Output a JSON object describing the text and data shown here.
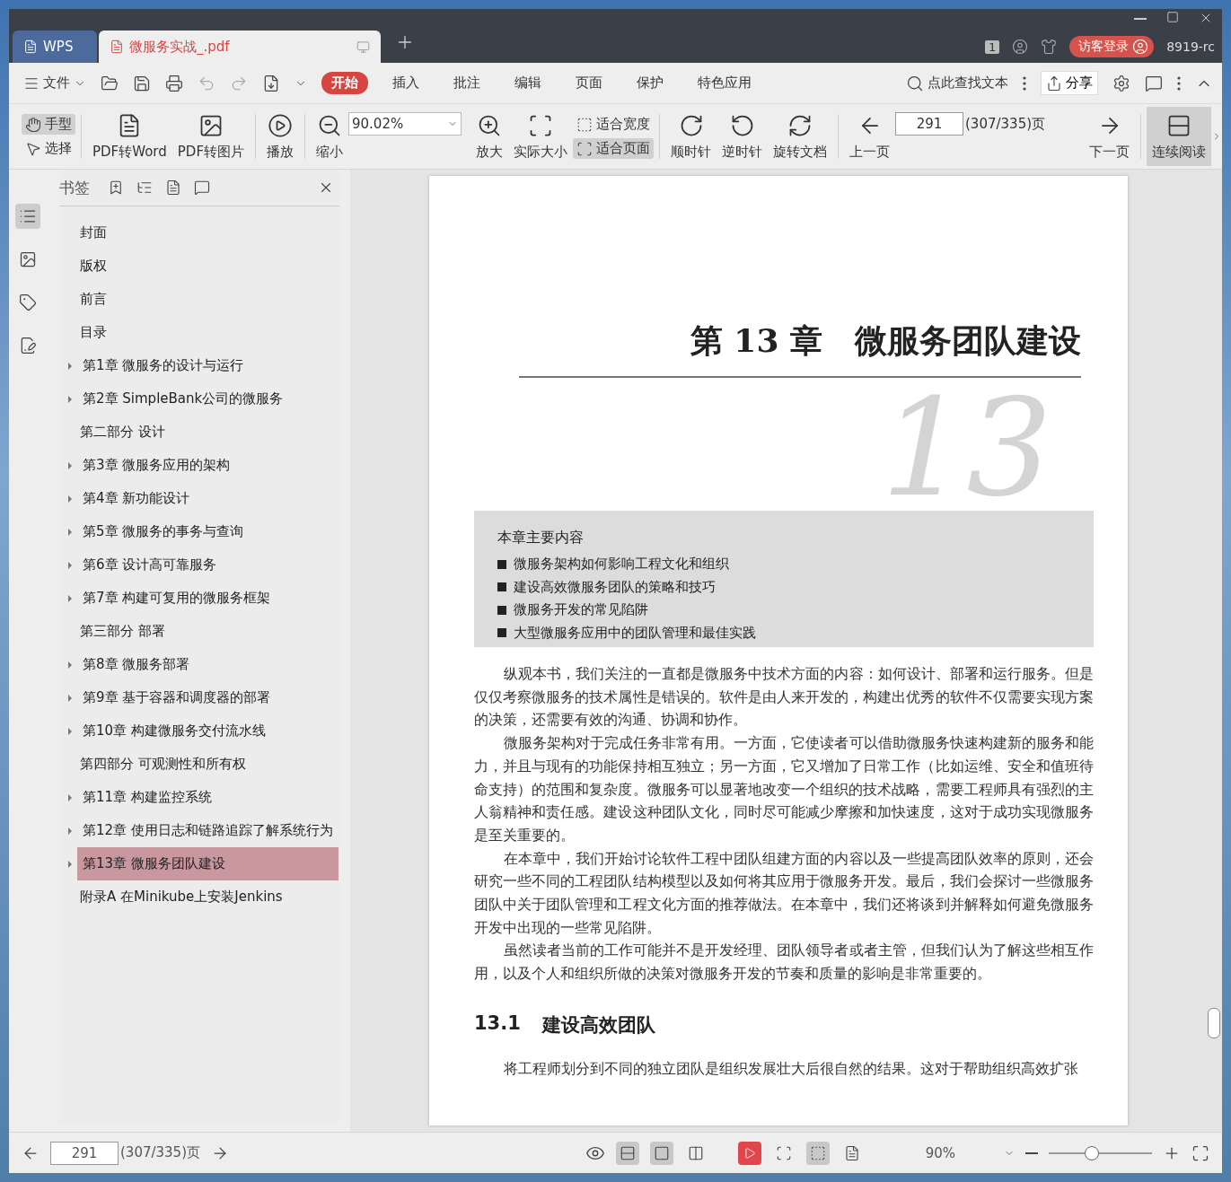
{
  "titlebar": {
    "tabs": [
      {
        "label": "WPS",
        "kind": "home",
        "selected": false
      },
      {
        "label": "微服务实战_.pdf",
        "kind": "doc",
        "selected": true
      }
    ],
    "badge": "1",
    "login": "访客登录",
    "user": "8919-rc"
  },
  "menubar": {
    "file": "文件",
    "tabs": [
      {
        "label": "开始",
        "selected": true
      },
      {
        "label": "插入",
        "selected": false
      },
      {
        "label": "批注",
        "selected": false
      },
      {
        "label": "编辑",
        "selected": false
      },
      {
        "label": "页面",
        "selected": false
      },
      {
        "label": "保护",
        "selected": false
      },
      {
        "label": "特色应用",
        "selected": false
      }
    ],
    "search": "点此查找文本",
    "share": "分享"
  },
  "toolbar": [
    {
      "kind": "pair",
      "items": [
        {
          "label": "手型",
          "selected": true
        },
        {
          "label": "选择",
          "selected": false
        }
      ]
    },
    {
      "kind": "tool",
      "label": "PDF转Word",
      "selected": false
    },
    {
      "kind": "tool",
      "label": "PDF转图片",
      "selected": false
    },
    {
      "kind": "tool",
      "label": "播放",
      "selected": false
    },
    {
      "kind": "tool",
      "label": "缩小",
      "selected": false
    },
    {
      "kind": "zoom",
      "value": "90.02%"
    },
    {
      "kind": "tool",
      "label": "放大",
      "selected": false
    },
    {
      "kind": "tool",
      "label": "实际大小",
      "selected": false
    },
    {
      "kind": "pair",
      "items": [
        {
          "label": "适合宽度",
          "selected": false
        },
        {
          "label": "适合页面",
          "selected": true
        }
      ]
    },
    {
      "kind": "tool",
      "label": "顺时针",
      "selected": false
    },
    {
      "kind": "tool",
      "label": "逆时针",
      "selected": false
    },
    {
      "kind": "tool",
      "label": "旋转文档",
      "selected": false
    },
    {
      "kind": "tool",
      "label": "上一页",
      "selected": false
    },
    {
      "kind": "page",
      "value": "291",
      "total": "(307/335)页"
    },
    {
      "kind": "tool",
      "label": "下一页",
      "selected": false
    },
    {
      "kind": "tool",
      "label": "连续阅读",
      "selected": true
    }
  ],
  "rail": [
    {
      "selected": true
    },
    {
      "selected": false
    },
    {
      "selected": false
    },
    {
      "selected": false
    }
  ],
  "bookmarks": {
    "title": "书签",
    "items": [
      {
        "label": "封面",
        "expandable": false,
        "selected": false
      },
      {
        "label": "版权",
        "expandable": false,
        "selected": false
      },
      {
        "label": "前言",
        "expandable": false,
        "selected": false
      },
      {
        "label": "目录",
        "expandable": false,
        "selected": false
      },
      {
        "label": "第1章 微服务的设计与运行",
        "expandable": true,
        "selected": false
      },
      {
        "label": "第2章 SimpleBank公司的微服务",
        "expandable": true,
        "selected": false
      },
      {
        "label": "第二部分 设计",
        "expandable": false,
        "selected": false
      },
      {
        "label": "第3章 微服务应用的架构",
        "expandable": true,
        "selected": false
      },
      {
        "label": "第4章 新功能设计",
        "expandable": true,
        "selected": false
      },
      {
        "label": "第5章 微服务的事务与查询",
        "expandable": true,
        "selected": false
      },
      {
        "label": "第6章 设计高可靠服务",
        "expandable": true,
        "selected": false
      },
      {
        "label": "第7章 构建可复用的微服务框架",
        "expandable": true,
        "selected": false
      },
      {
        "label": "第三部分 部署",
        "expandable": false,
        "selected": false
      },
      {
        "label": "第8章 微服务部署",
        "expandable": true,
        "selected": false
      },
      {
        "label": "第9章 基于容器和调度器的部署",
        "expandable": true,
        "selected": false
      },
      {
        "label": "第10章 构建微服务交付流水线",
        "expandable": true,
        "selected": false
      },
      {
        "label": "第四部分 可观测性和所有权",
        "expandable": false,
        "selected": false
      },
      {
        "label": "第11章 构建监控系统",
        "expandable": true,
        "selected": false
      },
      {
        "label": "第12章 使用日志和链路追踪了解系统行为",
        "expandable": true,
        "selected": false
      },
      {
        "label": "第13章 微服务团队建设",
        "expandable": true,
        "selected": true
      },
      {
        "label": "附录A 在Minikube上安装Jenkins",
        "expandable": false,
        "selected": false
      }
    ]
  },
  "page": {
    "chapter_number": "13",
    "title": "第 13 章　微服务团队建设",
    "summary_title": "本章主要内容",
    "summary": [
      "微服务架构如何影响工程文化和组织",
      "建设高效微服务团队的策略和技巧",
      "微服务开发的常见陷阱",
      "大型微服务应用中的团队管理和最佳实践"
    ],
    "paragraphs": [
      "纵观本书，我们关注的一直都是微服务中技术方面的内容：如何设计、部署和运行服务。但是仅仅考察微服务的技术属性是错误的。软件是由人来开发的，构建出优秀的软件不仅需要实现方案的决策，还需要有效的沟通、协调和协作。",
      "微服务架构对于完成任务非常有用。一方面，它使读者可以借助微服务快速构建新的服务和能力，并且与现有的功能保持相互独立；另一方面，它又增加了日常工作（比如运维、安全和值班待命支持）的范围和复杂度。微服务可以显著地改变一个组织的技术战略，需要工程师具有强烈的主人翁精神和责任感。建设这种团队文化，同时尽可能减少摩擦和加快速度，这对于成功实现微服务是至关重要的。",
      "在本章中，我们开始讨论软件工程中团队组建方面的内容以及一些提高团队效率的原则，还会研究一些不同的工程团队结构模型以及如何将其应用于微服务开发。最后，我们会探讨一些微服务团队中关于团队管理和工程文化方面的推荐做法。在本章中，我们还将谈到并解释如何避免微服务开发中出现的一些常见陷阱。",
      "虽然读者当前的工作可能并不是开发经理、团队领导者或者主管，但我们认为了解这些相互作用，以及个人和组织所做的决策对微服务开发的节奏和质量的影响是非常重要的。"
    ],
    "section_number": "13.1",
    "section_title": "建设高效团队",
    "after": "将工程师划分到不同的独立团队是组织发展壮大后很自然的结果。这对于帮助组织高效扩张"
  },
  "statusbar": {
    "page": "291",
    "total": "(307/335)页",
    "views": [
      {
        "selected": true
      },
      {
        "selected": true
      },
      {
        "selected": false
      }
    ],
    "fits": [
      {
        "selected": false
      },
      {
        "selected": true
      },
      {
        "selected": false
      }
    ],
    "zoom": "90%",
    "zoom_slider": {
      "level": 0.42
    }
  }
}
